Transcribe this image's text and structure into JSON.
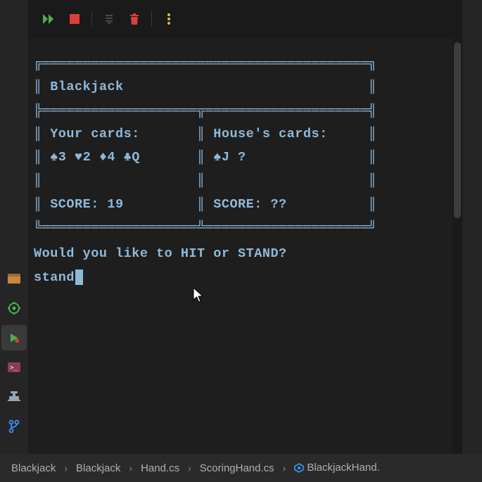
{
  "toolbar": {
    "continue": "continue",
    "stop": "stop",
    "lines": "lines",
    "trash": "trash",
    "more": "more"
  },
  "terminal": {
    "box_top": "╔════════════════════════════════════════╗",
    "title_row": "║ Blackjack                              ║",
    "divider": "╠═══════════════════╦════════════════════╣",
    "header_row": "║ Your cards:       ║ House's cards:     ║",
    "cards_row": "║ ♠3 ♥2 ♦4 ♣Q       ║ ♠J ?               ║",
    "blank_row": "║                   ║                    ║",
    "score_row": "║ SCORE: 19         ║ SCORE: ??          ║",
    "box_bottom": "╚═══════════════════╩════════════════════╝",
    "prompt": "Would you like to HIT or STAND?",
    "input": "stand"
  },
  "sidebar": {
    "items": [
      {
        "name": "package-icon"
      },
      {
        "name": "gear-icon"
      },
      {
        "name": "run-icon"
      },
      {
        "name": "terminal-icon"
      },
      {
        "name": "alert-icon"
      },
      {
        "name": "branch-icon"
      }
    ]
  },
  "breadcrumb": {
    "items": [
      {
        "label": "Blackjack",
        "icon": null
      },
      {
        "label": "Blackjack",
        "icon": null
      },
      {
        "label": "Hand.cs",
        "icon": null
      },
      {
        "label": "ScoringHand.cs",
        "icon": null
      },
      {
        "label": "BlackjackHand.",
        "icon": "hex"
      }
    ]
  },
  "game": {
    "title": "Blackjack",
    "player": {
      "label": "Your cards:",
      "cards": [
        "♠3",
        "♥2",
        "♦4",
        "♣Q"
      ],
      "score_label": "SCORE:",
      "score": 19
    },
    "house": {
      "label": "House's cards:",
      "cards": [
        "♠J",
        "?"
      ],
      "score_label": "SCORE:",
      "score": "??"
    },
    "prompt": "Would you like to HIT or STAND?",
    "user_input": "stand"
  }
}
